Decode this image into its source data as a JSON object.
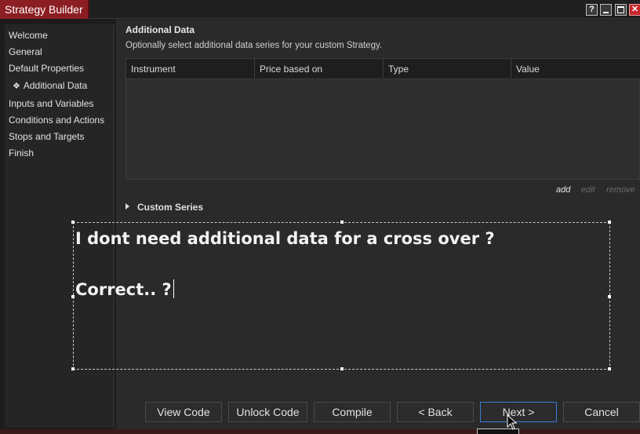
{
  "window": {
    "title": "Strategy Builder",
    "buttons": {
      "help": "?",
      "close": "✕"
    },
    "colors": {
      "title_bg": "#8b1e22",
      "close_bg": "#c8262d",
      "accent": "#3a7bd5"
    }
  },
  "nav": {
    "items": [
      {
        "label": "Welcome"
      },
      {
        "label": "General"
      },
      {
        "label": "Default Properties"
      },
      {
        "label": "Additional Data",
        "active": true,
        "bullet": "❖"
      },
      {
        "label": "Inputs and Variables"
      },
      {
        "label": "Conditions and Actions"
      },
      {
        "label": "Stops and Targets"
      },
      {
        "label": "Finish"
      }
    ]
  },
  "main": {
    "title": "Additional Data",
    "subtitle": "Optionally select additional data series for your custom Strategy.",
    "grid": {
      "columns": [
        "Instrument",
        "Price based on",
        "Type",
        "Value"
      ],
      "rows": []
    },
    "actions": {
      "add": "add",
      "edit": "edit",
      "remove": "remove"
    },
    "custom_series": {
      "label": "Custom Series"
    }
  },
  "annotation": {
    "line1": "I dont need additional data for a cross over ?",
    "line2": "Correct.. ?"
  },
  "footer": {
    "view_code": "View Code",
    "unlock_code": "Unlock Code",
    "compile": "Compile",
    "back": "< Back",
    "next": "Next >",
    "cancel": "Cancel"
  }
}
